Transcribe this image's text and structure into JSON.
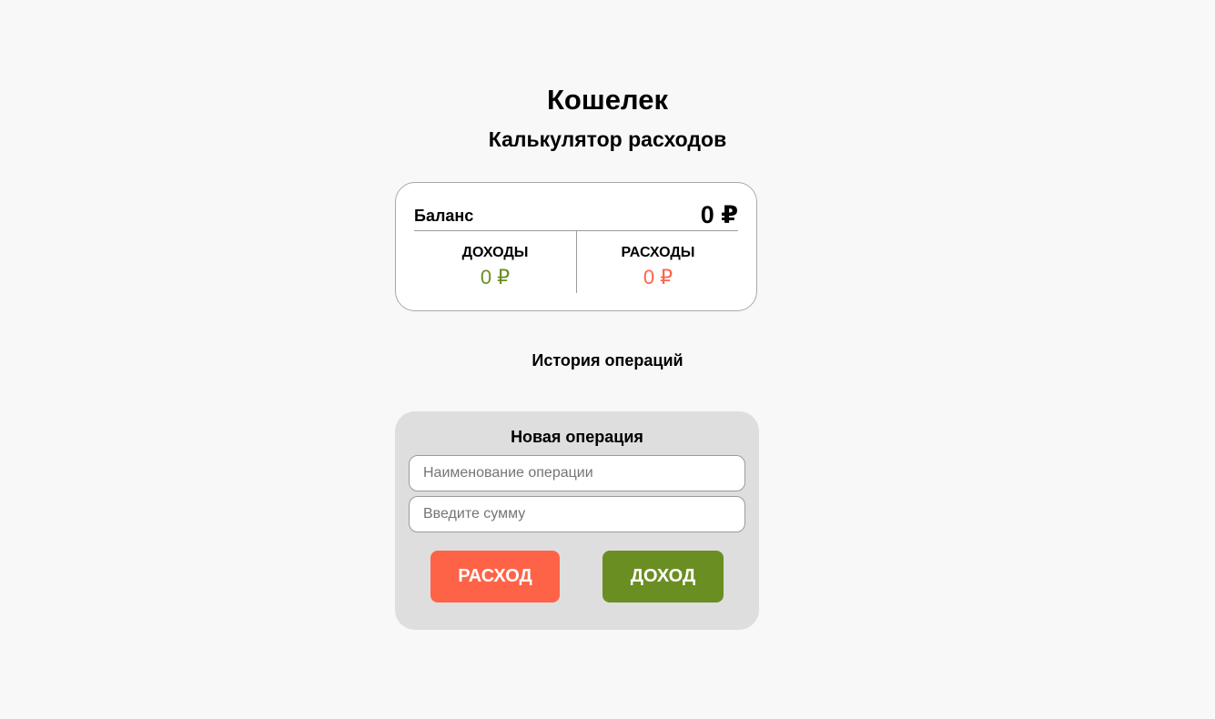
{
  "header": {
    "title": "Кошелек",
    "subtitle": "Калькулятор расходов"
  },
  "balance": {
    "label": "Баланс",
    "value": "0 ₽",
    "income": {
      "label": "ДОХОДЫ",
      "value": "0 ₽"
    },
    "expense": {
      "label": "РАСХОДЫ",
      "value": "0 ₽"
    }
  },
  "history": {
    "title": "История операций"
  },
  "form": {
    "title": "Новая операция",
    "name_placeholder": "Наименование операции",
    "name_value": "",
    "sum_placeholder": "Введите сумму",
    "sum_value": "",
    "expense_button": "Расход",
    "income_button": "Доход"
  },
  "colors": {
    "background": "#f8f8f8",
    "income": "#6b8e23",
    "expense": "#ff6347",
    "form_background": "#dedede"
  }
}
